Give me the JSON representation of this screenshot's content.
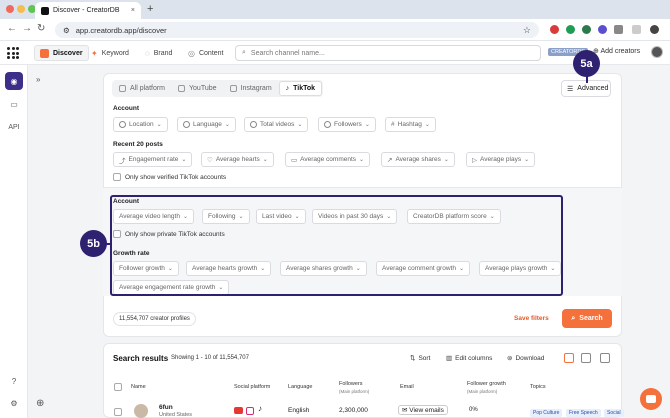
{
  "browser": {
    "tab_title": "Discover - CreatorDB",
    "url": "app.creatordb.app/discover"
  },
  "header": {
    "nav": [
      {
        "label": "Discover",
        "icon": "discover-icon",
        "active": true
      },
      {
        "label": "Keyword",
        "icon": "keyword-icon",
        "active": false
      },
      {
        "label": "Brand",
        "icon": "brand-icon",
        "active": false
      },
      {
        "label": "Content",
        "icon": "content-icon",
        "active": false
      }
    ],
    "search_placeholder": "Search channel name...",
    "badge": "CREATORDB",
    "add_creators": "Add creators"
  },
  "sidebar": {
    "api_label": "API"
  },
  "filters": {
    "platform_tabs": [
      {
        "label": "All platform",
        "active": false
      },
      {
        "label": "YouTube",
        "active": false
      },
      {
        "label": "Instagram",
        "active": false
      },
      {
        "label": "TikTok",
        "active": true
      }
    ],
    "advanced_label": "Advanced",
    "account_label": "Account",
    "account_chips": [
      "Location",
      "Language",
      "Total videos",
      "Followers",
      "Hashtag"
    ],
    "recent_label": "Recent 20 posts",
    "recent_chips": [
      "Engagement rate",
      "Average hearts",
      "Average comments",
      "Average shares",
      "Average plays"
    ],
    "verified_label": "Only show verified TikTok accounts"
  },
  "advanced": {
    "account_label": "Account",
    "account_chips": [
      "Average video length",
      "Following",
      "Last video",
      "Videos in past 30 days",
      "CreatorDB platform score"
    ],
    "private_label": "Only show private TikTok accounts",
    "growth_label": "Growth rate",
    "growth_chips": [
      "Follower growth",
      "Average hearts growth",
      "Average shares growth",
      "Average comment growth",
      "Average plays growth",
      "Average engagement rate growth"
    ]
  },
  "callouts": {
    "a": "5a",
    "b": "5b"
  },
  "footer": {
    "profiles": "11,554,707 creator profiles",
    "save_filters": "Save filters",
    "search": "Search"
  },
  "results": {
    "title": "Search results",
    "subtitle": "Showing 1 - 10 of 11,554,707",
    "sort": "Sort",
    "edit_columns": "Edit columns",
    "download": "Download",
    "columns": {
      "name": "Name",
      "social": "Social platform",
      "language": "Language",
      "followers": "Followers",
      "followers_sub": "(Main platform)",
      "email": "Email",
      "growth": "Follower growth",
      "growth_sub": "(Main platform)",
      "topics": "Topics"
    },
    "row": {
      "name": "6fun",
      "name_sub": "United States",
      "language": "English",
      "followers": "2,300,000",
      "email": "View emails",
      "growth": "0%",
      "topics": [
        "Pop Culture",
        "Free Speech",
        "Social"
      ]
    }
  },
  "colors": {
    "accent": "#f4713c",
    "highlight": "#2e2170",
    "active_sidebar": "#3b2f8a"
  }
}
